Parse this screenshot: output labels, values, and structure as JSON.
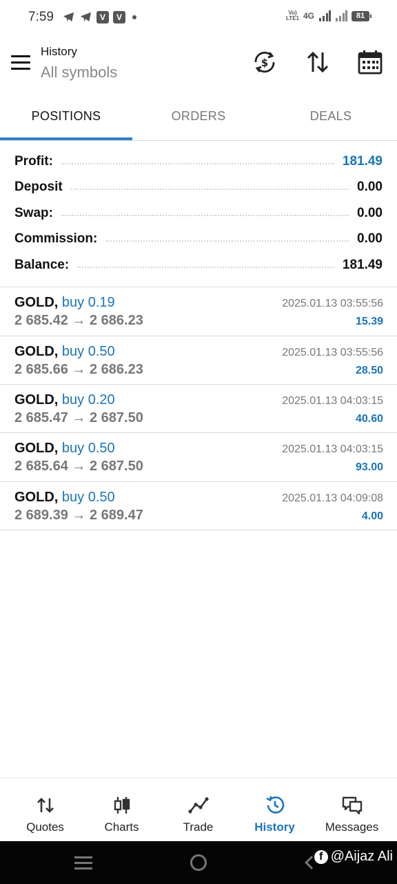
{
  "status_bar": {
    "time": "7:59",
    "volte": "Vo)\nLTE1",
    "network": "4G",
    "battery": "81",
    "notif_letter": "V"
  },
  "header": {
    "title": "History",
    "subtitle": "All symbols"
  },
  "tabs": [
    {
      "label": "POSITIONS",
      "active": true
    },
    {
      "label": "ORDERS",
      "active": false
    },
    {
      "label": "DEALS",
      "active": false
    }
  ],
  "summary": [
    {
      "label": "Profit:",
      "value": "181.49",
      "highlight": true
    },
    {
      "label": "Deposit",
      "value": "0.00",
      "highlight": false
    },
    {
      "label": "Swap:",
      "value": "0.00",
      "highlight": false
    },
    {
      "label": "Commission:",
      "value": "0.00",
      "highlight": false
    },
    {
      "label": "Balance:",
      "value": "181.49",
      "highlight": false
    }
  ],
  "positions": [
    {
      "symbol": "GOLD,",
      "side": "buy 0.19",
      "open": "2 685.42",
      "arrow": "→",
      "close": "2 686.23",
      "time": "2025.01.13 03:55:56",
      "profit": "15.39"
    },
    {
      "symbol": "GOLD,",
      "side": "buy 0.50",
      "open": "2 685.66",
      "arrow": "→",
      "close": "2 686.23",
      "time": "2025.01.13 03:55:56",
      "profit": "28.50"
    },
    {
      "symbol": "GOLD,",
      "side": "buy 0.20",
      "open": "2 685.47",
      "arrow": "→",
      "close": "2 687.50",
      "time": "2025.01.13 04:03:15",
      "profit": "40.60"
    },
    {
      "symbol": "GOLD,",
      "side": "buy 0.50",
      "open": "2 685.64",
      "arrow": "→",
      "close": "2 687.50",
      "time": "2025.01.13 04:03:15",
      "profit": "93.00"
    },
    {
      "symbol": "GOLD,",
      "side": "buy 0.50",
      "open": "2 689.39",
      "arrow": "→",
      "close": "2 689.47",
      "time": "2025.01.13 04:09:08",
      "profit": "4.00"
    }
  ],
  "bottom_nav": [
    {
      "label": "Quotes",
      "icon": "quotes-arrows-icon",
      "active": false
    },
    {
      "label": "Charts",
      "icon": "candlestick-icon",
      "active": false
    },
    {
      "label": "Trade",
      "icon": "trend-line-icon",
      "active": false
    },
    {
      "label": "History",
      "icon": "history-clock-icon",
      "active": true
    },
    {
      "label": "Messages",
      "icon": "chat-bubbles-icon",
      "active": false
    }
  ],
  "watermark": {
    "icon_letter": "f",
    "text": "@Aijaz Ali"
  },
  "colors": {
    "accent": "#1a74b8",
    "tab_underline": "#2f80c8",
    "muted_text": "#777777"
  }
}
